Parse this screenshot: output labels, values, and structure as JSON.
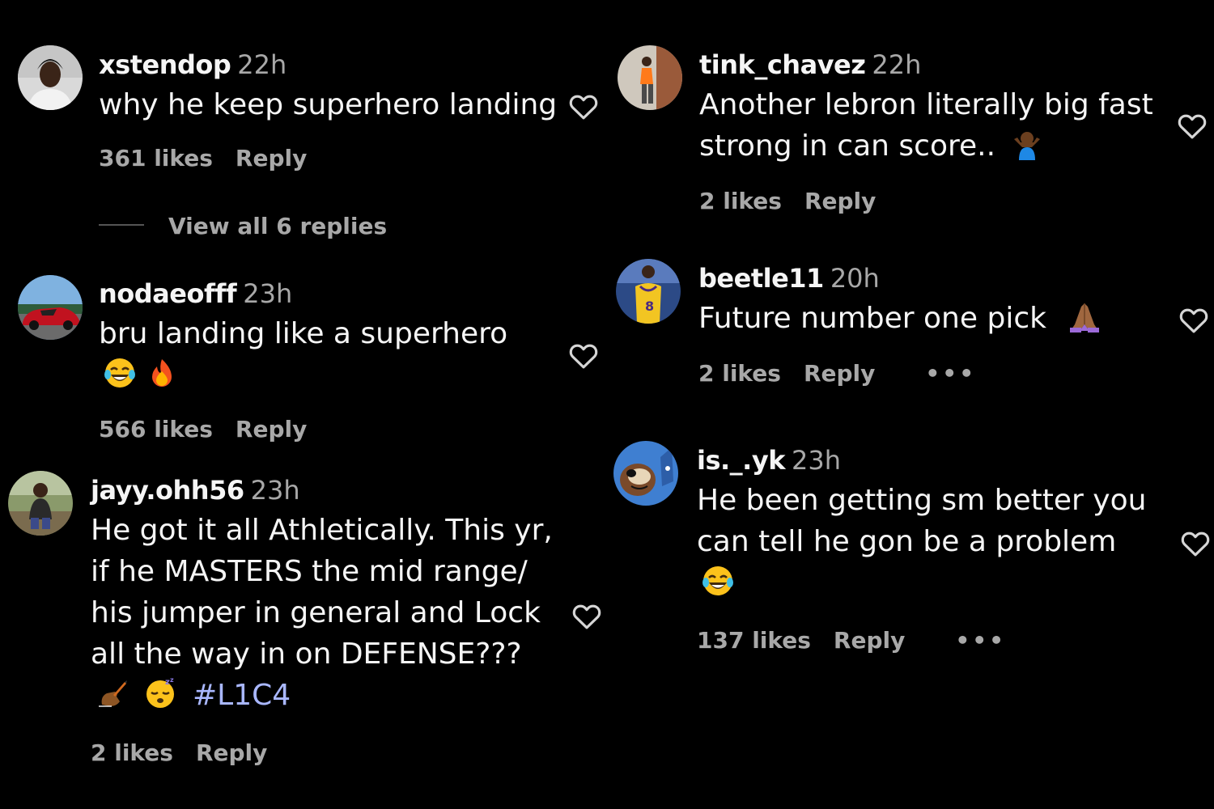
{
  "comments": [
    {
      "username": "xstendop",
      "time": "22h",
      "lines": [
        "why he keep superhero landing"
      ],
      "likes": "361 likes",
      "reply": "Reply",
      "view_replies": "View all 6 replies"
    },
    {
      "username": "nodaeofff",
      "time": "23h",
      "lines": [
        "bru landing like a superhero"
      ],
      "emojis": [
        "face-with-tears-of-joy-emoji",
        "fire-emoji"
      ],
      "likes": "566 likes",
      "reply": "Reply"
    },
    {
      "username": "jayy.ohh56",
      "time": "23h",
      "lines": [
        "He got it all Athletically. This yr,",
        "if he MASTERS the mid range/",
        "his jumper in general and Lock",
        "all the way in on DEFENSE???"
      ],
      "emojis": [
        "writing-hand-emoji",
        "sleeping-face-emoji"
      ],
      "hashtag": "#L1C4",
      "likes": "2 likes",
      "reply": "Reply"
    },
    {
      "username": "tink_chavez",
      "time": "22h",
      "lines": [
        "Another lebron literally big fast",
        "strong in can score.."
      ],
      "emojis": [
        "person-shrugging-emoji"
      ],
      "likes": "2 likes",
      "reply": "Reply"
    },
    {
      "username": "beetle11",
      "time": "20h",
      "lines": [
        "Future number one pick"
      ],
      "emojis": [
        "folded-hands-emoji"
      ],
      "likes": "2 likes",
      "reply": "Reply",
      "more": "•••"
    },
    {
      "username": "is._.yk",
      "time": "23h",
      "lines": [
        "He been getting sm better you",
        "can tell he gon be a problem"
      ],
      "emojis": [
        "face-with-tears-of-joy-emoji"
      ],
      "likes": "137 likes",
      "reply": "Reply",
      "more": "•••"
    }
  ],
  "colors": {
    "background": "#000000",
    "text": "#f5f5f5",
    "secondary": "#a8a8a8",
    "hashtag": "#a9b7ff"
  }
}
